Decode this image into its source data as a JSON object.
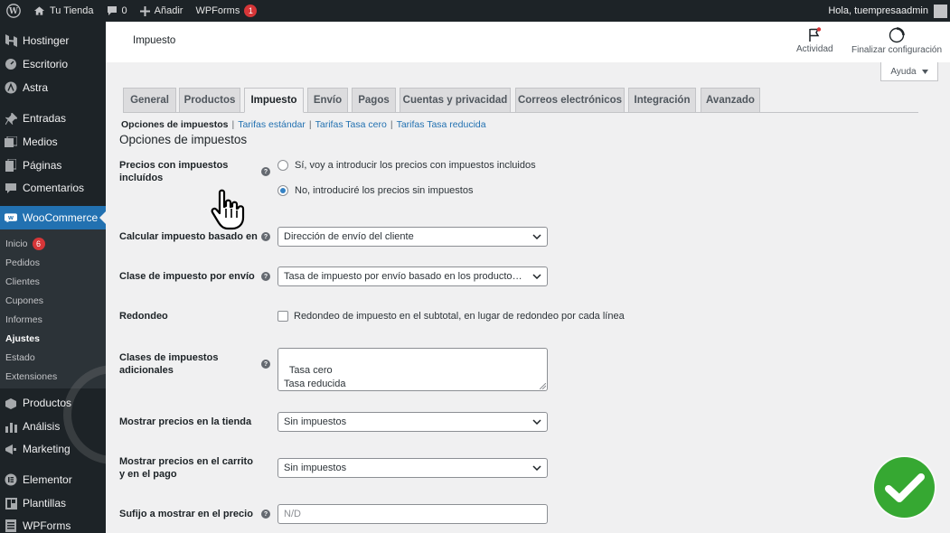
{
  "admin_bar": {
    "site_name": "Tu Tienda",
    "comments_count": "0",
    "add_new": "Añadir",
    "wpforms": "WPForms",
    "wpforms_badge": "1",
    "greeting": "Hola, tuempresaadmin"
  },
  "sidebar": {
    "items": [
      {
        "label": "Hostinger",
        "icon": "hostinger-icon"
      },
      {
        "label": "Escritorio",
        "icon": "dashboard-icon"
      },
      {
        "label": "Astra",
        "icon": "astra-icon"
      },
      {
        "label": "Entradas",
        "icon": "pin-icon"
      },
      {
        "label": "Medios",
        "icon": "media-icon"
      },
      {
        "label": "Páginas",
        "icon": "pages-icon"
      },
      {
        "label": "Comentarios",
        "icon": "comments-icon"
      },
      {
        "label": "WooCommerce",
        "icon": "woocommerce-icon"
      }
    ],
    "submenu": [
      {
        "label": "Inicio",
        "badge": "6"
      },
      {
        "label": "Pedidos"
      },
      {
        "label": "Clientes"
      },
      {
        "label": "Cupones"
      },
      {
        "label": "Informes"
      },
      {
        "label": "Ajustes"
      },
      {
        "label": "Estado"
      },
      {
        "label": "Extensiones"
      }
    ],
    "items_after": [
      {
        "label": "Productos",
        "icon": "products-icon"
      },
      {
        "label": "Análisis",
        "icon": "analytics-icon"
      },
      {
        "label": "Marketing",
        "icon": "marketing-icon"
      },
      {
        "label": "Elementor",
        "icon": "elementor-icon"
      },
      {
        "label": "Plantillas",
        "icon": "templates-icon"
      },
      {
        "label": "WPForms",
        "icon": "wpforms-icon"
      }
    ]
  },
  "header": {
    "title": "Impuesto",
    "activity": "Actividad",
    "finish_setup": "Finalizar configuración",
    "help": "Ayuda"
  },
  "tabs": [
    "General",
    "Productos",
    "Impuesto",
    "Envío",
    "Pagos",
    "Cuentas y privacidad",
    "Correos electrónicos",
    "Integración",
    "Avanzado"
  ],
  "active_tab": "Impuesto",
  "sections": {
    "current": "Opciones de impuestos",
    "links": [
      "Tarifas estándar",
      "Tarifas Tasa cero",
      "Tarifas Tasa reducida"
    ]
  },
  "section_title": "Opciones de impuestos",
  "form": {
    "prices_incl_tax": {
      "label": "Precios con impuestos incluídos",
      "options": [
        "Sí, voy a introducir los precios con impuestos incluidos",
        "No, introduciré los precios sin impuestos"
      ],
      "selected_index": 1
    },
    "tax_based_on": {
      "label": "Calcular impuesto basado en",
      "value": "Dirección de envío del cliente"
    },
    "shipping_tax_class": {
      "label": "Clase de impuesto por envío",
      "value": "Tasa de impuesto por envío basado en los productos del carrito"
    },
    "rounding": {
      "label": "Redondeo",
      "checkbox_label": "Redondeo de impuesto en el subtotal, en lugar de redondeo por cada línea",
      "checked": false
    },
    "additional_classes": {
      "label": "Clases de impuestos adicionales",
      "value": "Tasa cero\nTasa reducida"
    },
    "display_shop": {
      "label": "Mostrar precios en la tienda",
      "value": "Sin impuestos"
    },
    "display_cart": {
      "label": "Mostrar precios en el carrito y en el pago",
      "value": "Sin impuestos"
    },
    "price_suffix": {
      "label": "Sufijo a mostrar en el precio",
      "placeholder": "N/D"
    }
  },
  "colors": {
    "accent": "#2271b1",
    "adminbar": "#1d2327",
    "badge": "#d63638",
    "check": "#36a832"
  }
}
